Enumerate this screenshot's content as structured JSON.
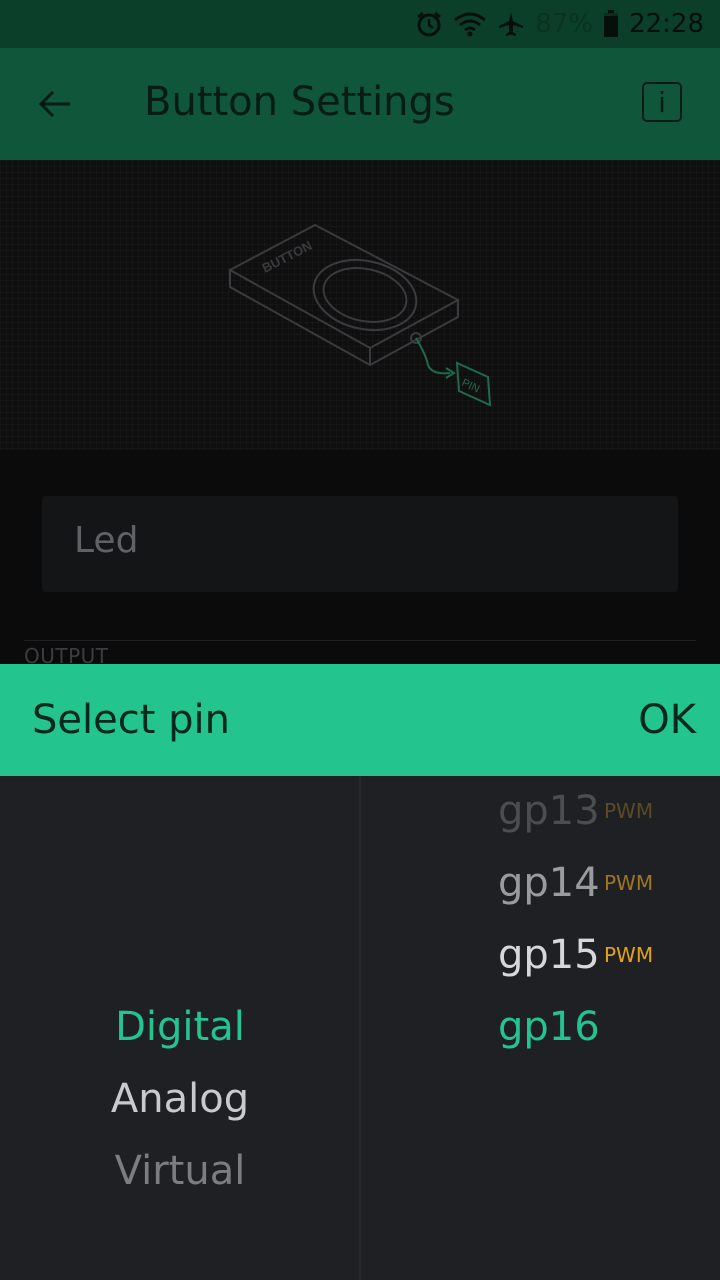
{
  "status_bar": {
    "battery_percent": "87%",
    "time": "22:28",
    "icons": [
      "alarm-icon",
      "wifi-icon",
      "airplane-icon",
      "battery-icon"
    ]
  },
  "app_bar": {
    "title": "Button Settings",
    "info_label": "i"
  },
  "illustration": {
    "button_label": "BUTTON",
    "pin_label": "PIN"
  },
  "name_field": {
    "value": "Led"
  },
  "output_label": "OUTPUT",
  "dialog": {
    "title": "Select pin",
    "ok_label": "OK"
  },
  "modes": [
    {
      "label": "Digital",
      "state": "selected"
    },
    {
      "label": "Analog",
      "state": "near"
    },
    {
      "label": "Virtual",
      "state": "far"
    }
  ],
  "pins": [
    {
      "label": "gp13",
      "badge": "PWM"
    },
    {
      "label": "gp14",
      "badge": "PWM"
    },
    {
      "label": "gp15",
      "badge": "PWM"
    },
    {
      "label": "gp16",
      "badge": ""
    }
  ],
  "colors": {
    "accent": "#23c48e",
    "pwm": "#e3a21c",
    "app_bar": "#10563a",
    "status_bar": "#0c3f29"
  }
}
